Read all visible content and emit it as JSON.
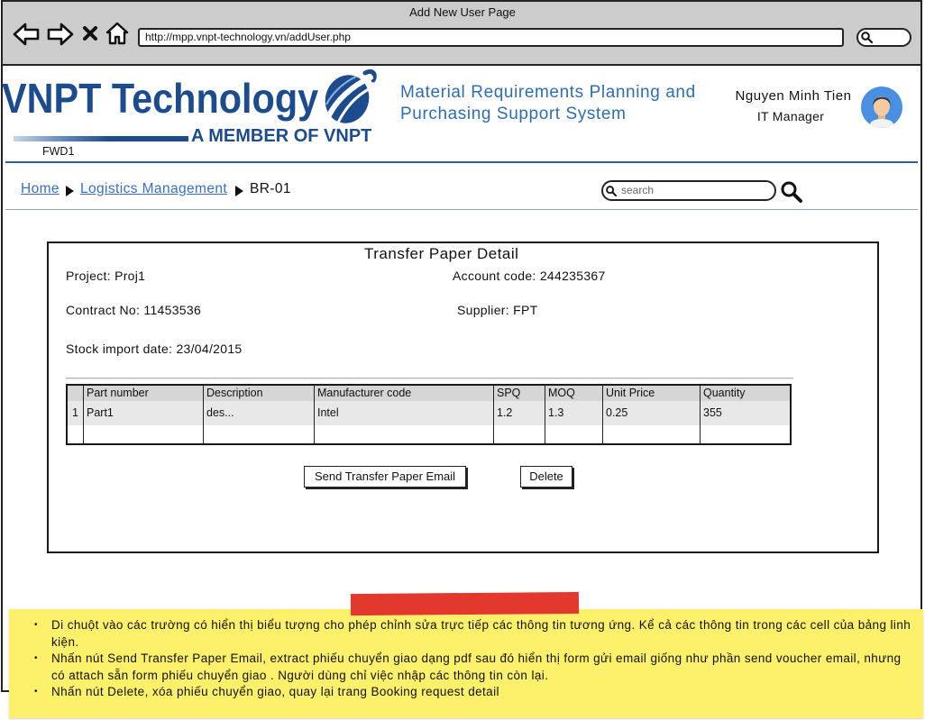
{
  "window": {
    "title": "Add New User Page",
    "url": "http://mpp.vnpt-technology.vn/addUser.php"
  },
  "brand": {
    "logo_text": "VNPT Technology",
    "tagline": "A MEMBER OF VNPT",
    "code": "FWD1"
  },
  "app_title": {
    "line1": "Material Requirements Planning and",
    "line2": "Purchasing Support System"
  },
  "user": {
    "name": "Nguyen Minh Tien",
    "role": "IT Manager"
  },
  "breadcrumb": {
    "home": "Home",
    "section": "Logistics Management",
    "current": "BR-01"
  },
  "search": {
    "placeholder": "search"
  },
  "panel": {
    "title": "Transfer Paper Detail",
    "project": {
      "label": "Project:",
      "value": "Proj1"
    },
    "account_code": {
      "label": "Account code:",
      "value": "244235367"
    },
    "contract_no": {
      "label": "Contract No:",
      "value": "11453536"
    },
    "supplier": {
      "label": "Supplier:",
      "value": "FPT"
    },
    "stock_import_date": {
      "label": "Stock import date:",
      "value": "23/04/2015"
    }
  },
  "table": {
    "columns": [
      "",
      "Part number",
      "Description",
      "Manufacturer code",
      "SPQ",
      "MOQ",
      "Unit Price",
      "Quantity"
    ],
    "rows": [
      [
        "1",
        "Part1",
        "des...",
        "Intel",
        "1.2",
        "1.3",
        "0.25",
        "355"
      ]
    ]
  },
  "buttons": {
    "send_email": "Send Transfer Paper Email",
    "delete": "Delete"
  },
  "note": {
    "items": [
      "Di chuột vào các trường có hiển thị biểu tượng cho phép chỉnh sửa trực tiếp các thông tin tương ứng. Kể cả các thông tin trong các cell của bảng linh kiện.",
      "Nhấn nút Send Transfer Paper Email, extract phiếu chuyển giao dạng pdf sau đó hiển thị form gửi email giống như phần send voucher email, nhưng có attach sẵn form phiếu chuyển giao . Người dùng chỉ việc nhập các thông tin còn lại.",
      "Nhấn nút Delete, xóa phiếu chuyển giao, quay lại trang Booking request detail"
    ]
  },
  "icons": {
    "back": "back-arrow-icon",
    "forward": "forward-arrow-icon",
    "stop": "close-icon",
    "home": "home-icon",
    "search": "search-icon",
    "breadcrumb_separator": "triangle-right-icon",
    "logo": "vnpt-logo-icon",
    "avatar": "user-avatar-icon"
  },
  "colors": {
    "brand_blue": "#1c4c8e",
    "title_blue": "#2e6db3",
    "link_blue": "#3a6fc0",
    "chrome_gray": "#cccccc",
    "table_header_gray": "#d6d6d6",
    "table_row_gray": "#e8e8e8",
    "note_yellow": "#fdf06a",
    "tape_red": "#e2382e",
    "avatar_blue": "#4a90e2"
  }
}
